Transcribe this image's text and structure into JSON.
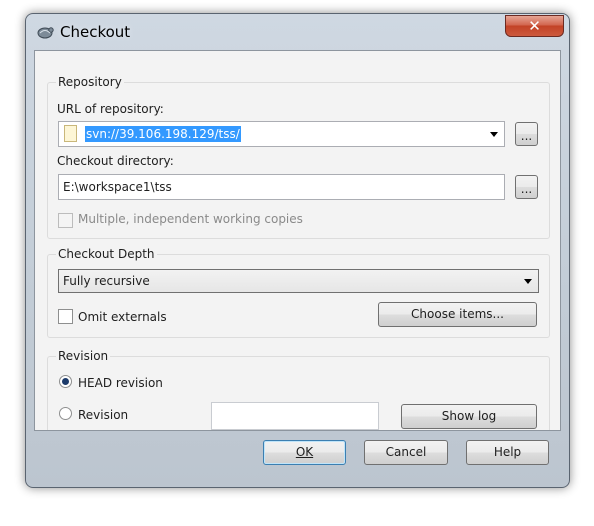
{
  "window": {
    "title": "Checkout",
    "close_glyph": "✕",
    "app_icon": "tortoisesvn-icon"
  },
  "repository": {
    "group_label": "Repository",
    "url_label": "URL of repository:",
    "url_value": "svn://39.106.198.129/tss/",
    "browse_label": "...",
    "dir_label": "Checkout directory:",
    "dir_value": "E:\\workspace1\\tss",
    "multiple_label": "Multiple, independent working copies",
    "multiple_checked": false
  },
  "depth": {
    "group_label": "Checkout Depth",
    "selected": "Fully recursive",
    "omit_label": "Omit externals",
    "omit_checked": false,
    "choose_items_label": "Choose items..."
  },
  "revision": {
    "group_label": "Revision",
    "head_label": "HEAD revision",
    "head_selected": true,
    "revision_label": "Revision",
    "revision_value": "",
    "show_log_label": "Show log"
  },
  "buttons": {
    "ok": "OK",
    "cancel": "Cancel",
    "help": "Help"
  },
  "colors": {
    "selection": "#3399ff",
    "close_button": "#c24226",
    "default_button_border": "#3c7fb1"
  }
}
